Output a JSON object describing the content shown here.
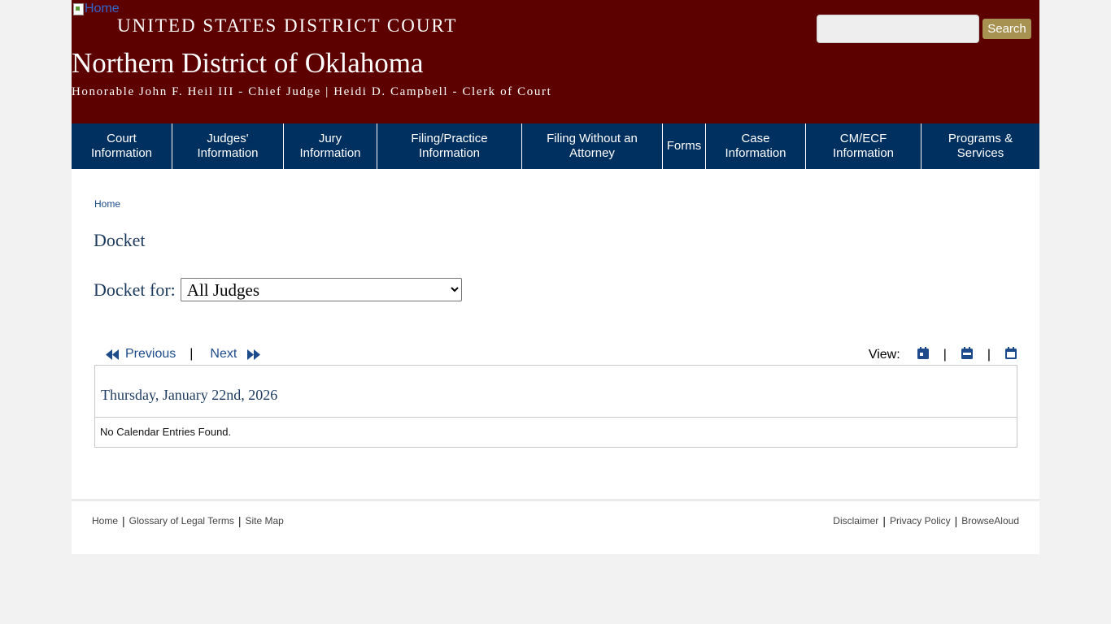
{
  "header": {
    "home_image_alt": "Home",
    "court_name": "UNITED STATES DISTRICT COURT",
    "district_name": "Northern District of Oklahoma",
    "officials": "Honorable John F. Heil III - Chief Judge | Heidi D. Campbell - Clerk of Court",
    "search_placeholder": "",
    "search_button": "Search"
  },
  "nav": {
    "items": [
      {
        "label": "Court\nInformation"
      },
      {
        "label": "Judges'\nInformation"
      },
      {
        "label": "Jury\nInformation"
      },
      {
        "label": "Filing/Practice\nInformation"
      },
      {
        "label": "Filing Without an\nAttorney"
      },
      {
        "label": "Forms"
      },
      {
        "label": "Case\nInformation"
      },
      {
        "label": "CM/ECF\nInformation"
      },
      {
        "label": "Programs &\nServices"
      }
    ]
  },
  "breadcrumb": {
    "home": "Home"
  },
  "page": {
    "title": "Docket",
    "docket_for_label": "Docket for:",
    "docket_select_value": "All Judges"
  },
  "pager": {
    "previous": "Previous",
    "separator": "|",
    "next": "Next",
    "view_label": "View:"
  },
  "calendar": {
    "date_heading": "Thursday, January 22nd, 2026",
    "empty_message": "No Calendar Entries Found."
  },
  "footer": {
    "left_links": [
      "Home",
      "Glossary of Legal Terms",
      "Site Map"
    ],
    "right_links": [
      "Disclaimer",
      "Privacy Policy",
      "BrowseAloud"
    ],
    "separator": "|"
  },
  "colors": {
    "header_bg": "#5c0000",
    "nav_bg": "#00305f",
    "search_button_bg": "#a89252",
    "link_blue": "#1c4a8a"
  }
}
